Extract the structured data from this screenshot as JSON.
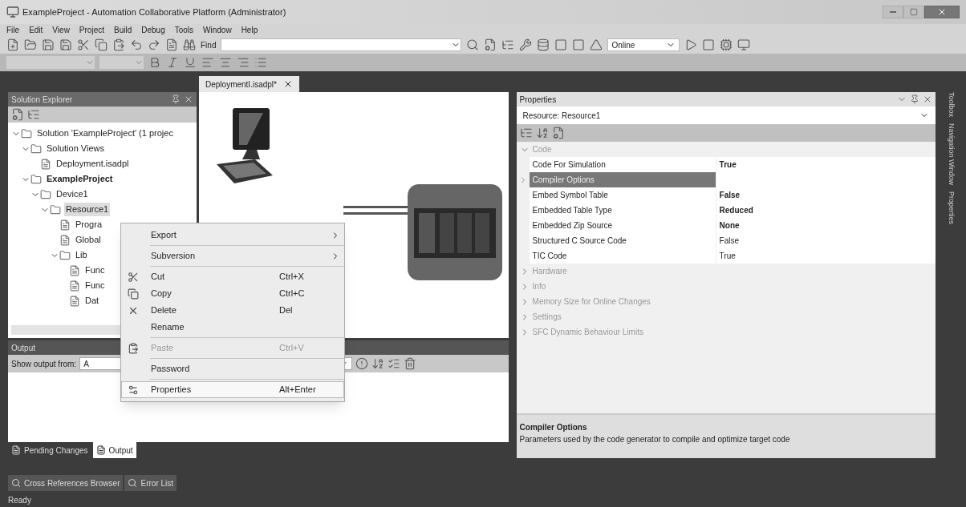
{
  "window": {
    "title": "ExampleProject - Automation Collaborative Platform (Administrator)"
  },
  "menu": [
    "File",
    "Edit",
    "View",
    "Project",
    "Build",
    "Debug",
    "Tools",
    "Window",
    "Help"
  ],
  "toolbar": {
    "find_label": "Find",
    "mode": "Online"
  },
  "solution_explorer": {
    "title": "Solution Explorer",
    "tree": [
      {
        "label": "Solution 'ExampleProject' (1 projec",
        "bold": false,
        "expanded": true,
        "selected": false,
        "children": [
          {
            "label": "Solution Views",
            "bold": false,
            "expanded": true,
            "selected": false,
            "children": [
              {
                "label": "Deployment.isadpl",
                "bold": false,
                "selected": false
              }
            ]
          },
          {
            "label": "ExampleProject",
            "bold": true,
            "expanded": true,
            "selected": false,
            "children": [
              {
                "label": "Device1",
                "bold": false,
                "expanded": true,
                "selected": false,
                "children": [
                  {
                    "label": "Resource1",
                    "bold": false,
                    "expanded": true,
                    "selected": true,
                    "children": [
                      {
                        "label": "Progra",
                        "bold": false,
                        "selected": false
                      },
                      {
                        "label": "Global",
                        "bold": false,
                        "selected": false
                      },
                      {
                        "label": "Lib",
                        "bold": false,
                        "expanded": true,
                        "selected": false,
                        "children": [
                          {
                            "label": "Func",
                            "bold": false,
                            "selected": false
                          },
                          {
                            "label": "Func",
                            "bold": false,
                            "selected": false
                          },
                          {
                            "label": "Dat",
                            "bold": false,
                            "selected": false
                          }
                        ]
                      }
                    ]
                  }
                ]
              }
            ]
          }
        ]
      }
    ]
  },
  "document_tab": {
    "title": "DeploymentI.isadpl*",
    "selected": true
  },
  "context_menu": [
    {
      "label": "Export",
      "submenu": true,
      "disabled": false,
      "selected": false,
      "separator_after": true
    },
    {
      "label": "Subversion",
      "submenu": true,
      "disabled": false,
      "selected": false,
      "separator_after": true
    },
    {
      "label": "Cut",
      "shortcut": "Ctrl+X",
      "submenu": false,
      "disabled": false,
      "selected": false,
      "separator_after": false
    },
    {
      "label": "Copy",
      "shortcut": "Ctrl+C",
      "submenu": false,
      "disabled": false,
      "selected": false,
      "separator_after": false
    },
    {
      "label": "Delete",
      "shortcut": "Del",
      "submenu": false,
      "disabled": false,
      "selected": false,
      "separator_after": false
    },
    {
      "label": "Rename",
      "submenu": false,
      "disabled": false,
      "selected": false,
      "separator_after": true
    },
    {
      "label": "Paste",
      "shortcut": "Ctrl+V",
      "submenu": false,
      "disabled": true,
      "selected": false,
      "separator_after": true
    },
    {
      "label": "Password",
      "submenu": false,
      "disabled": false,
      "selected": false,
      "separator_after": true
    },
    {
      "label": "Properties",
      "shortcut": "Alt+Enter",
      "submenu": false,
      "disabled": false,
      "selected": true,
      "separator_after": false
    }
  ],
  "output": {
    "title": "Output",
    "show_from_label": "Show output from:",
    "source": "A"
  },
  "bottom_tabs": [
    {
      "label": "Pending Changes",
      "selected": false
    },
    {
      "label": "Output",
      "selected": true
    }
  ],
  "tool_tabs": [
    "Cross References Browser",
    "Error List"
  ],
  "properties": {
    "title": "Properties",
    "object": "Resource: Resource1",
    "categories": [
      {
        "name": "Code",
        "expanded": true,
        "rows": [
          {
            "name": "Code For Simulation",
            "value": "True",
            "bold": true,
            "selected": false,
            "expandable": false
          },
          {
            "name": "Compiler Options",
            "value": "",
            "bold": false,
            "selected": true,
            "expandable": true
          },
          {
            "name": "Embed Symbol Table",
            "value": "False",
            "bold": true,
            "selected": false,
            "expandable": false
          },
          {
            "name": "Embedded Table Type",
            "value": "Reduced",
            "bold": true,
            "selected": false,
            "expandable": false
          },
          {
            "name": "Embedded Zip Source",
            "value": "None",
            "bold": true,
            "selected": false,
            "expandable": false
          },
          {
            "name": "Structured C Source Code",
            "value": "False",
            "bold": false,
            "selected": false,
            "expandable": false
          },
          {
            "name": "TIC Code",
            "value": "True",
            "bold": false,
            "selected": false,
            "expandable": false
          }
        ]
      },
      {
        "name": "Hardware",
        "expanded": false
      },
      {
        "name": "Info",
        "expanded": false
      },
      {
        "name": "Memory Size for Online Changes",
        "expanded": false
      },
      {
        "name": "Settings",
        "expanded": false
      },
      {
        "name": "SFC Dynamic Behaviour Limits",
        "expanded": false
      }
    ],
    "description_title": "Compiler Options",
    "description": "Parameters used by the code generator to compile and optimize target code"
  },
  "side_tabs": [
    "Toolbox",
    "Navigation Window",
    "Properties"
  ],
  "status_bar": "Ready"
}
